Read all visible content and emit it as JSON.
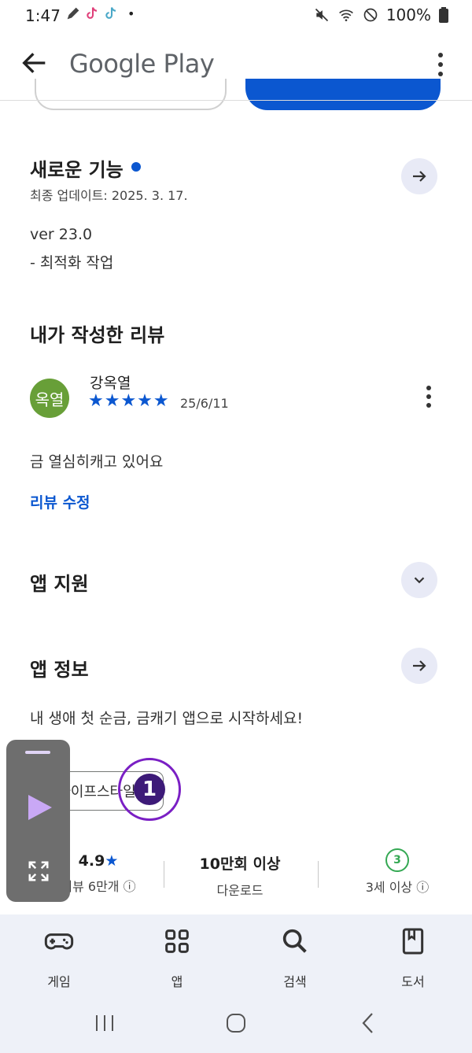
{
  "status_bar": {
    "time": "1:47",
    "notification_icons": [
      "edit-icon",
      "tiktok-icon",
      "tiktok-icon"
    ],
    "more_dot": "•",
    "battery": "100%"
  },
  "app_bar": {
    "title": "Google Play"
  },
  "whats_new": {
    "title": "새로운 기능",
    "updated": "최종 업데이트: 2025. 3. 17.",
    "version": "ver 23.0",
    "note": "- 최적화 작업"
  },
  "my_review": {
    "title": "내가 작성한 리뷰",
    "avatar_text": "옥열",
    "reviewer_name": "강옥열",
    "rating": "★★★★★",
    "date": "25/6/11",
    "text": "금 열심히캐고 있어요",
    "edit_label": "리뷰 수정"
  },
  "app_support": {
    "title": "앱 지원"
  },
  "app_info": {
    "title": "앱 정보",
    "description": "내 생애 첫 순금, 금캐기 앱으로 시작하세요!",
    "category_chip": "라이프스타일",
    "badge_number": "1"
  },
  "stats": {
    "rating_value": "4.9",
    "rating_star": "★",
    "reviews_label": "리뷰 6만개",
    "downloads_value": "10만회 이상",
    "downloads_label": "다운로드",
    "age_value": "3",
    "age_label": "3세 이상",
    "info_glyph": "ⓘ"
  },
  "bottom_nav": {
    "items": [
      {
        "label": "게임",
        "icon": "gamepad-icon"
      },
      {
        "label": "앱",
        "icon": "apps-grid-icon"
      },
      {
        "label": "검색",
        "icon": "search-icon"
      },
      {
        "label": "도서",
        "icon": "book-icon"
      }
    ]
  },
  "colors": {
    "accent": "#0b57d0",
    "avatar_bg": "#689f38",
    "age_badge": "#34a853",
    "nav_bg": "#eef1f8"
  }
}
